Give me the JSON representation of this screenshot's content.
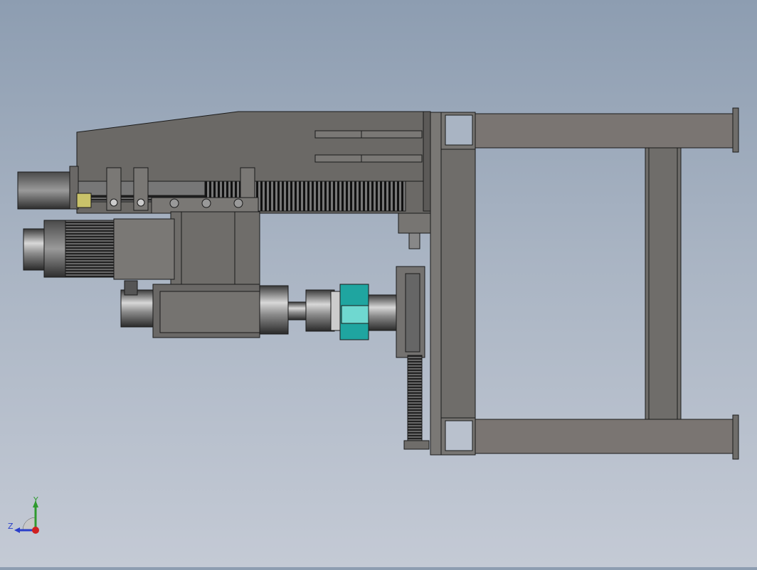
{
  "viewport": {
    "background_top": "#8d9db1",
    "background_bottom": "#c4cad5",
    "model_fill": "#6f6d6a",
    "model_edge": "#1a1a1a",
    "accent_teal": "#1fa5a0",
    "accent_yellow": "#c9c36a"
  },
  "triad": {
    "y_label": "Y",
    "z_label": "Z",
    "y_color": "#2f9a2f",
    "z_color": "#2a3fc9",
    "x_color": "#d02020"
  }
}
